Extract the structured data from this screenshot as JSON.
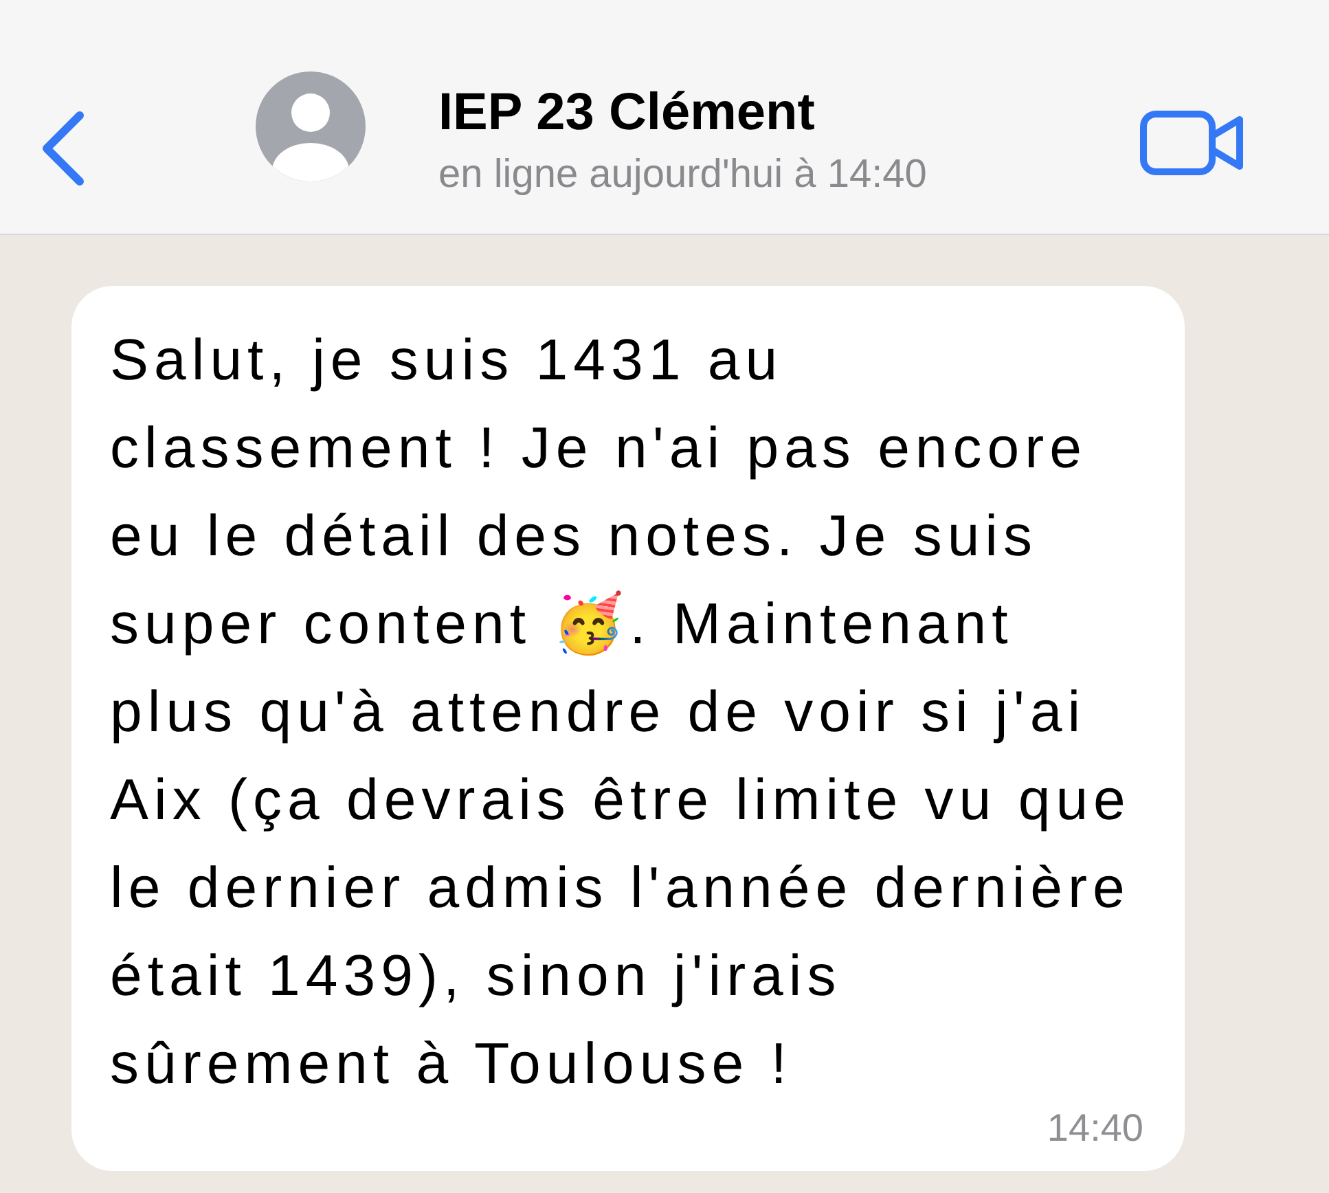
{
  "header": {
    "title": "IEP 23 Clément",
    "subtitle": "en ligne aujourd'hui à 14:40"
  },
  "messages": [
    {
      "text": "Salut, je suis 1431 au classement ! Je n'ai pas encore eu le détail des notes. Je suis super content 🥳. Maintenant plus qu'à attendre de voir si j'ai Aix (ça devrais être limite vu que le dernier admis l'année dernière était 1439), sinon j'irais sûrement à Toulouse !",
      "time": "14:40"
    }
  ]
}
